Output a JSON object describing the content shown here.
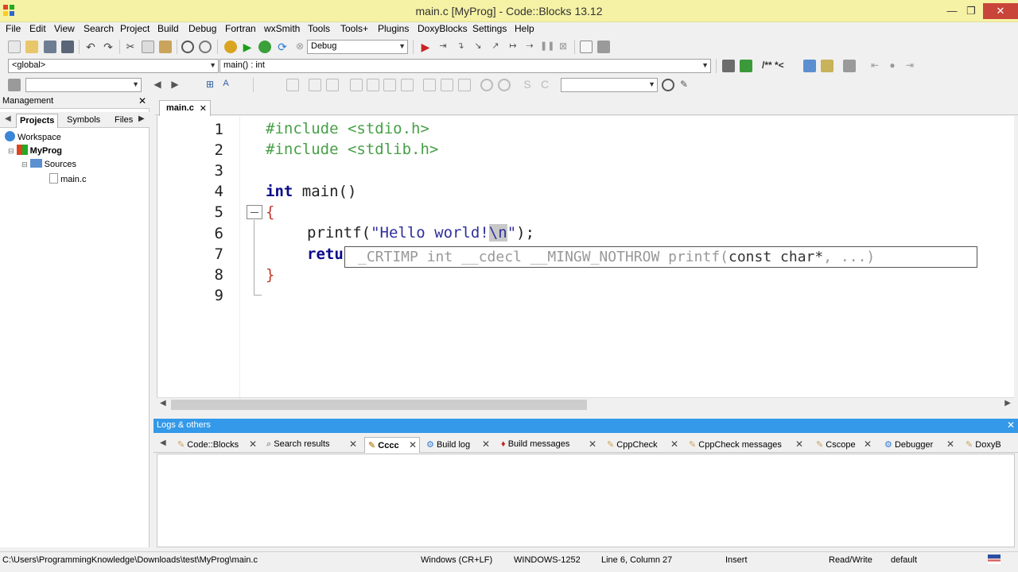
{
  "window": {
    "title": "main.c [MyProg] - Code::Blocks 13.12",
    "minimize": "—",
    "maximize": "❐",
    "close": "✕"
  },
  "menu": [
    "File",
    "Edit",
    "View",
    "Search",
    "Project",
    "Build",
    "Debug",
    "Fortran",
    "wxSmith",
    "Tools",
    "Tools+",
    "Plugins",
    "DoxyBlocks",
    "Settings",
    "Help"
  ],
  "toolbar": {
    "build_target": "Debug",
    "scope": "<global>",
    "function": "main() : int",
    "comment_label": "/** *<",
    "search_value": "",
    "second_search_value": ""
  },
  "management": {
    "title": "Management",
    "close": "✕",
    "tabs": [
      "Projects",
      "Symbols",
      "Files"
    ],
    "tree": {
      "workspace": "Workspace",
      "project": "MyProg",
      "folder": "Sources",
      "file": "main.c"
    }
  },
  "editor": {
    "tab_label": "main.c",
    "tab_close": "✕",
    "line_numbers": [
      "1",
      "2",
      "3",
      "4",
      "5",
      "6",
      "7",
      "8",
      "9"
    ],
    "lines": {
      "l1_directive": "#include",
      "l1_header": "<stdio.h>",
      "l2_directive": "#include",
      "l2_header": "<stdlib.h>",
      "l4_type": "int",
      "l4_name": "main()",
      "l5_brace": "{",
      "l6_func": "printf(",
      "l6_str_a": "\"Hello world!",
      "l6_str_hl": "\\n",
      "l6_str_b": "\"",
      "l6_tail": ");",
      "l7_partial": "retu",
      "l8_brace": "}"
    },
    "calltip": {
      "prefix": "_CRTIMP int __cdecl __MINGW_NOTHROW printf(",
      "arg": "const char*",
      "suffix": ", ...)"
    }
  },
  "logs": {
    "title": "Logs & others",
    "close": "✕",
    "tabs": [
      "Code::Blocks",
      "Search results",
      "Cccc",
      "Build log",
      "Build messages",
      "CppCheck",
      "CppCheck messages",
      "Cscope",
      "Debugger",
      "DoxyB"
    ],
    "tab_close": "✕"
  },
  "status": {
    "path": "C:\\Users\\ProgrammingKnowledge\\Downloads\\test\\MyProg\\main.c",
    "eol": "Windows (CR+LF)",
    "encoding": "WINDOWS-1252",
    "position": "Line 6, Column 27",
    "mode": "Insert",
    "access": "Read/Write",
    "profile": "default"
  },
  "colors": {
    "titlebar": "#f5f2a6",
    "logs_header": "#3399e8",
    "preprocessor": "#47a047",
    "keyword": "#0a0a8a",
    "brace": "#c0392b"
  }
}
